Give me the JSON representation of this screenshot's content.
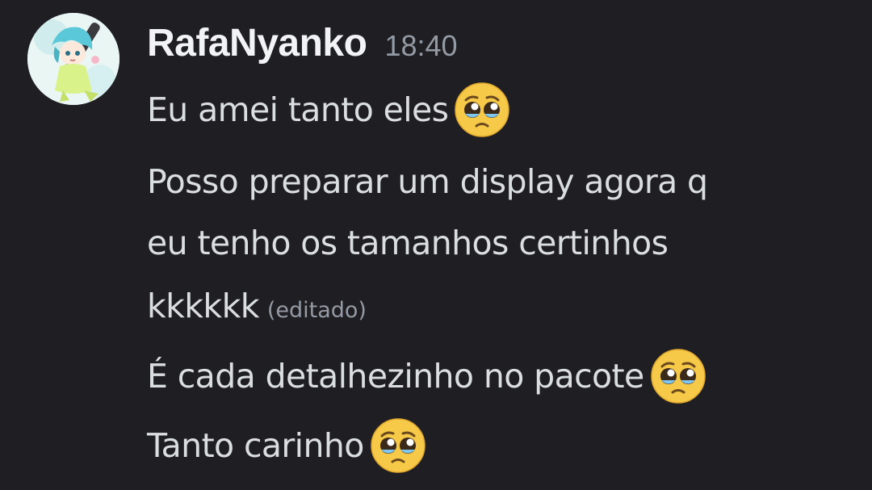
{
  "message": {
    "username": "RafaNyanko",
    "timestamp": "18:40",
    "avatar_icon": "anime-character-avatar",
    "lines": [
      {
        "text": "Eu amei tanto eles",
        "emoji": "pleading-face"
      },
      {
        "text": "Posso preparar um display agora q"
      },
      {
        "text": "eu tenho os tamanhos certinhos"
      },
      {
        "text": "kkkkkk",
        "edited_label": "(editado)"
      },
      {
        "text": "É cada detalhezinho no pacote",
        "emoji": "pleading-face"
      },
      {
        "text": "Tanto carinho",
        "emoji": "pleading-face"
      }
    ]
  },
  "colors": {
    "background": "#1f1f23",
    "username": "#f2f3f5",
    "text": "#dbdee1",
    "muted": "#949ba4"
  }
}
